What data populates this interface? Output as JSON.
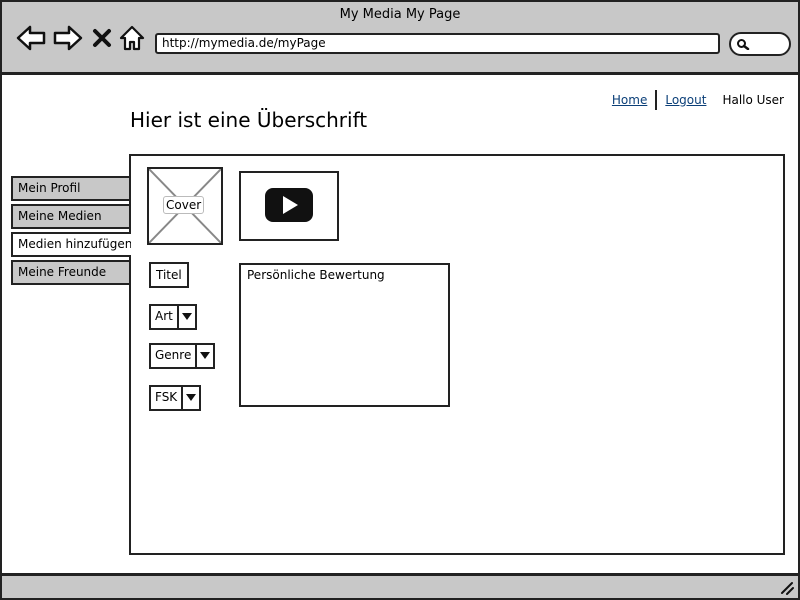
{
  "window": {
    "title": "My Media My Page",
    "url": "http://mymedia.de/myPage"
  },
  "toolbar": {
    "icons": [
      "back-arrow-icon",
      "forward-arrow-icon",
      "close-icon",
      "home-icon",
      "search-icon"
    ]
  },
  "header": {
    "links": {
      "home": "Home",
      "logout": "Logout"
    },
    "user_greeting": "Hallo User",
    "title": "Hier ist eine Überschrift"
  },
  "sidebar": {
    "items": [
      {
        "label": "Mein Profil",
        "active": false
      },
      {
        "label": "Meine Medien",
        "active": false
      },
      {
        "label": "Medien hinzufügen",
        "active": true
      },
      {
        "label": "Meine Freunde",
        "active": false
      }
    ]
  },
  "content": {
    "cover_label": "Cover",
    "title_field": "Titel",
    "dropdowns": {
      "art": "Art",
      "genre": "Genre",
      "fsk": "FSK"
    },
    "rating_label": "Persönliche Bewertung"
  },
  "colors": {
    "chrome_gray": "#c8c8c8",
    "link_blue": "#0b3f78",
    "border": "#222222"
  }
}
